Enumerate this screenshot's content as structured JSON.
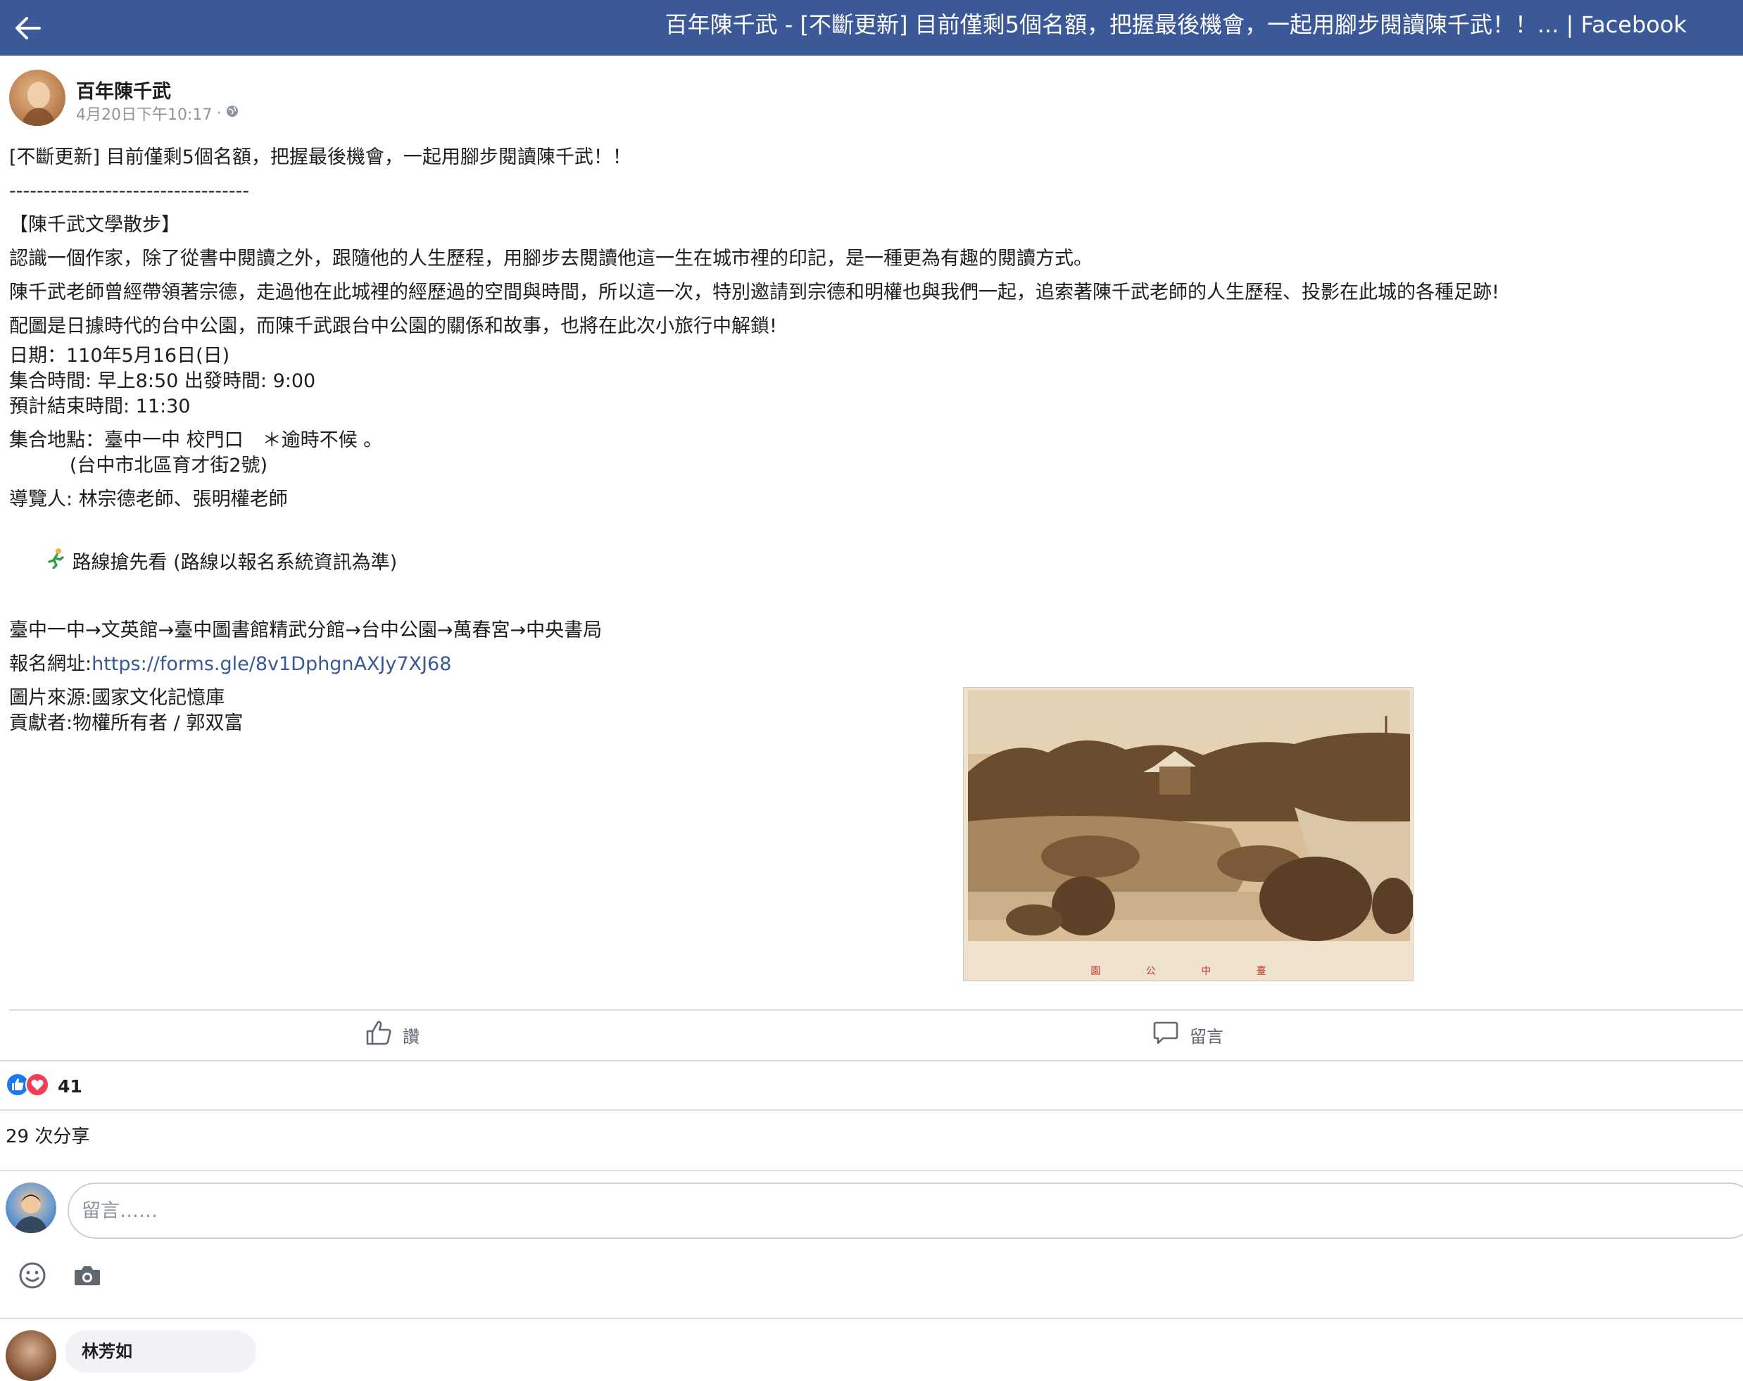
{
  "header": {
    "back_icon": "arrow-left-icon",
    "title": "百年陳千武 - [不斷更新] 目前僅剩5個名額，把握最後機會，一起用腳步閱讀陳千武！！... | Facebook"
  },
  "post": {
    "author": "百年陳千武",
    "timestamp": "4月20日下午10:17",
    "privacy_icon": "globe-icon",
    "lines": {
      "headline": "[不斷更新] 目前僅剩5個名額，把握最後機會，一起用腳步閱讀陳千武！！",
      "separator": "-----------------------------------",
      "section_title": "【陳千武文學散步】",
      "p1": "認識一個作家，除了從書中閱讀之外，跟隨他的人生歷程，用腳步去閱讀他這一生在城市裡的印記，是一種更為有趣的閱讀方式。",
      "p2": "陳千武老師曾經帶領著宗德，走過他在此城裡的經歷過的空間與時間，所以這一次，特別邀請到宗德和明權也與我們一起，追索著陳千武老師的人生歷程、投影在此城的各種足跡!",
      "p3": "配圖是日據時代的台中公園，而陳千武跟台中公園的關係和故事，也將在此次小旅行中解鎖!",
      "date": "日期：110年5月16日(日)",
      "time": "集合時間: 早上8:50 出發時間: 9:00",
      "end_time": "預計結束時間: 11:30",
      "location": "集合地點：臺中一中 校門口　＊逾時不候 。",
      "address": "          (台中市北區育才街2號)",
      "guides": "導覽人: 林宗德老師、張明權老師",
      "route_title": "路線搶先看 (路線以報名系統資訊為準)",
      "route": "臺中一中→文英館→臺中圖書館精武分館→台中公園→萬春宮→中央書局",
      "signup_label": "報名網址:",
      "signup_url": "https://forms.gle/8v1DphgnAXJy7XJ68",
      "image_source": "圖片來源:國家文化記憶庫",
      "contributor": "貢獻者:物權所有者 / 郭双富"
    },
    "image_caption": "園 公 中 臺",
    "route_emoji_icon": "runner-emoji-icon"
  },
  "actions": {
    "like_label": "讚",
    "like_icon": "thumbs-up-icon",
    "comment_label": "留言",
    "comment_icon": "speech-bubble-icon"
  },
  "stats": {
    "reaction_count": "41",
    "reaction_icons": [
      "like-reaction-icon",
      "love-reaction-icon"
    ],
    "shares": "29 次分享"
  },
  "composer": {
    "placeholder": "留言……",
    "emoji_icon": "smiley-icon",
    "camera_icon": "camera-icon"
  },
  "comments": [
    {
      "name": "林芳如"
    }
  ],
  "colors": {
    "header_bg": "#3b5998",
    "link": "#385898",
    "text": "#1c1e21",
    "muted": "#90949c"
  }
}
